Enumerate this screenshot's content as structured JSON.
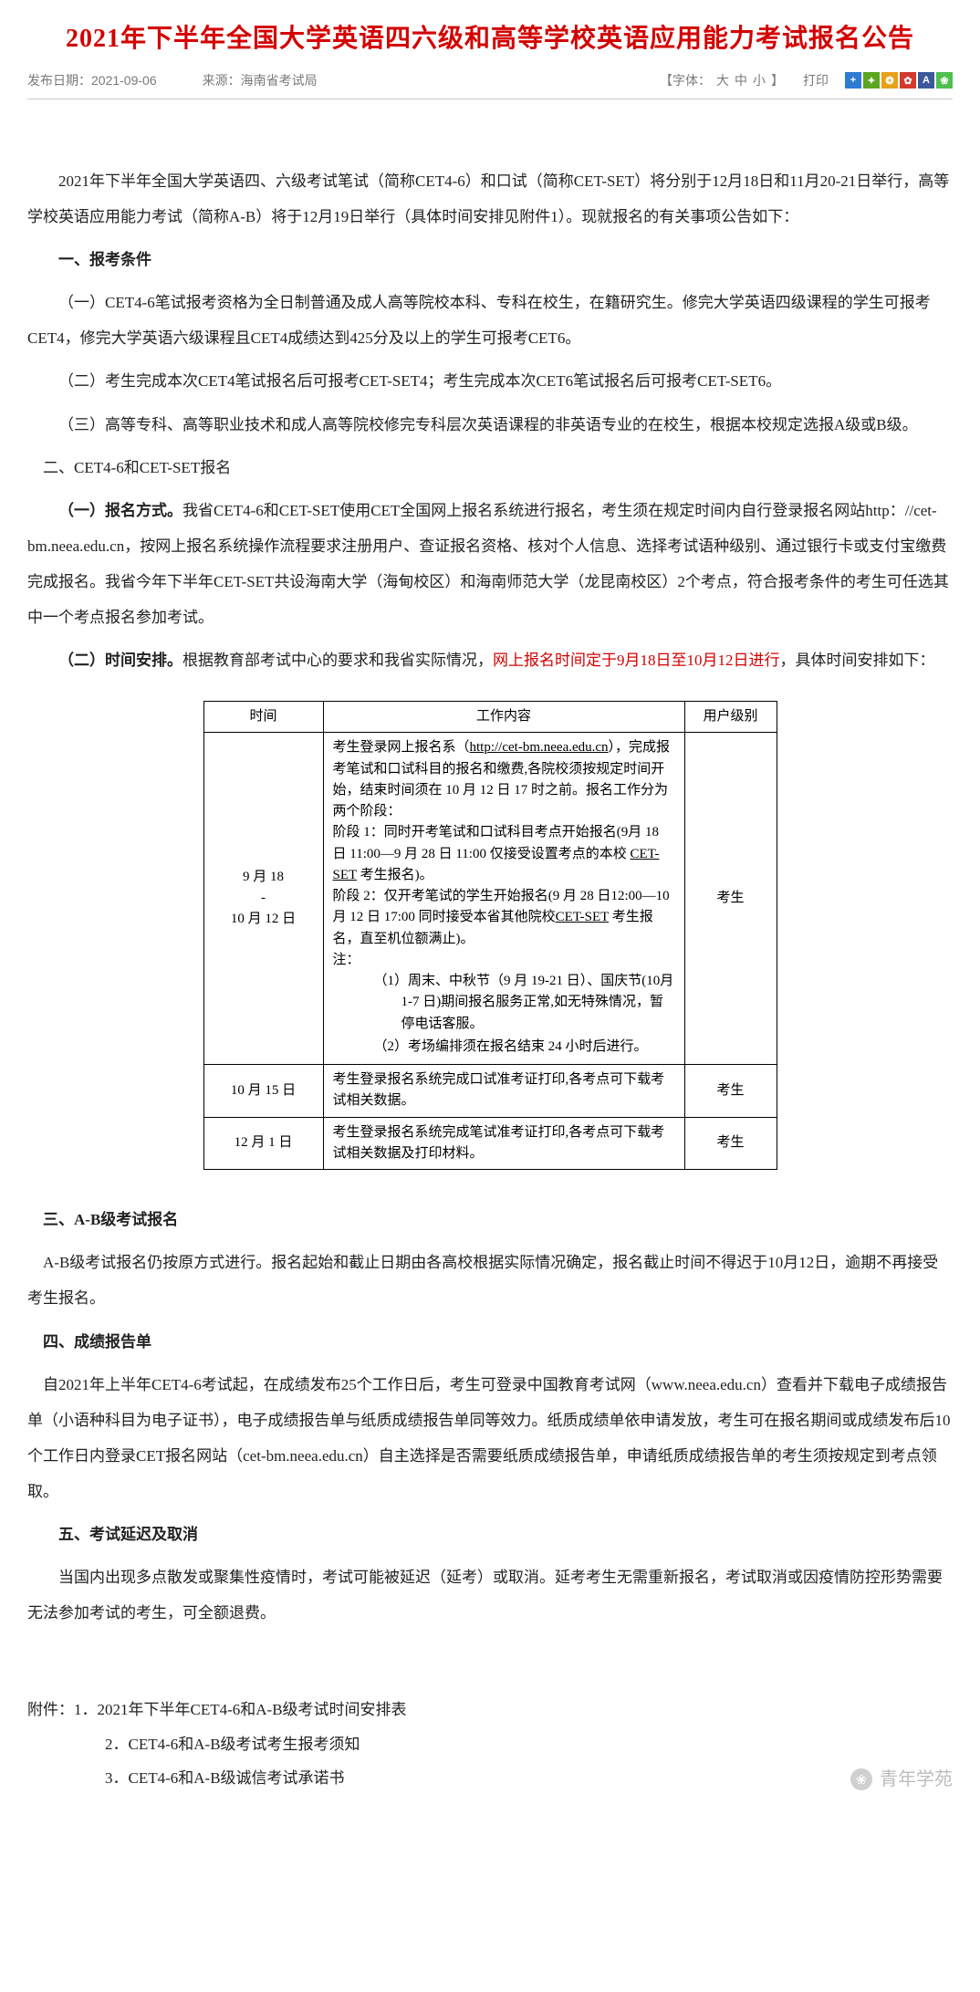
{
  "title": "2021年下半年全国大学英语四六级和高等学校英语应用能力考试报名公告",
  "meta": {
    "date_label": "发布日期：",
    "date": "2021-09-06",
    "source_label": "来源：",
    "source": "海南省考试局",
    "font_label": "【字体：",
    "font_large": "大",
    "font_mid": "中",
    "font_small": "小",
    "font_close": "】",
    "print": "打印"
  },
  "share_colors": [
    "#2f7bd4",
    "#5ca61f",
    "#e6a219",
    "#d23a2e",
    "#3b5998",
    "#4fbf4f"
  ],
  "intro": "2021年下半年全国大学英语四、六级考试笔试（简称CET4-6）和口试（简称CET-SET）将分别于12月18日和11月20-21日举行，高等学校英语应用能力考试（简称A-B）将于12月19日举行（具体时间安排见附件1）。现就报名的有关事项公告如下：",
  "h1": "一、报考条件",
  "c1a": "（一）CET4-6笔试报考资格为全日制普通及成人高等院校本科、专科在校生，在籍研究生。修完大学英语四级课程的学生可报考CET4，修完大学英语六级课程且CET4成绩达到425分及以上的学生可报考CET6。",
  "c1b": "（二）考生完成本次CET4笔试报名后可报考CET-SET4；考生完成本次CET6笔试报名后可报考CET-SET6。",
  "c1c": "（三）高等专科、高等职业技术和成人高等院校修完专科层次英语课程的非英语专业的在校生，根据本校规定选报A级或B级。",
  "h2": "二、CET4-6和CET-SET报名",
  "c2a_b": "（一）报名方式。",
  "c2a": "我省CET4-6和CET-SET使用CET全国网上报名系统进行报名，考生须在规定时间内自行登录报名网站http：//cet-bm.neea.edu.cn，按网上报名系统操作流程要求注册用户、查证报名资格、核对个人信息、选择考试语种级别、通过银行卡或支付宝缴费完成报名。我省今年下半年CET-SET共设海南大学（海甸校区）和海南师范大学（龙昆南校区）2个考点，符合报考条件的考生可任选其中一个考点报名参加考试。",
  "c2b_b": "（二）时间安排。",
  "c2b1": "根据教育部考试中心的要求和我省实际情况，",
  "c2b_red": "网上报名时间定于9月18日至10月12日进行",
  "c2b2": "，具体时间安排如下：",
  "table": {
    "h_time": "时间",
    "h_work": "工作内容",
    "h_role": "用户级别",
    "r1": {
      "time1": "9 月 18",
      "time2": "-",
      "time3": "10 月 12 日",
      "w_l1a": "考生登录网上报名系（",
      "w_url": "http://cet-bm.neea.edu.cn",
      "w_l1b": "），完成报考笔试和口试科目的报名和缴费,各院校须按规定时间开始，结束时间须在 10 月 12 日 17 时之前。报名工作分为两个阶段：",
      "w_l2a": "阶段 1：同时开考笔试和口试科目考点开始报名(9月 18 日 11:00—9 月 28 日 11:00 仅接受设置考点的本校 ",
      "w_u1": "CET-SET",
      "w_l2b": " 考生报名)。",
      "w_l3a": "阶段 2：仅开考笔试的学生开始报名(9 月 28 日12:00—10 月 12 日 17:00 同时接受本省其他院校",
      "w_u2": "CET-SET",
      "w_l3b": " 考生报名，直至机位额满止)。",
      "w_note": "注：",
      "w_n1": "（1）周末、中秋节（9 月 19-21 日）、国庆节(10月 1-7 日)期间报名服务正常,如无特殊情况，暂停电话客服。",
      "w_n2": "（2）考场编排须在报名结束 24 小时后进行。",
      "role": "考生"
    },
    "r2": {
      "time": "10 月 15 日",
      "work": "考生登录报名系统完成口试准考证打印,各考点可下载考试相关数据。",
      "role": "考生"
    },
    "r3": {
      "time": "12 月 1 日",
      "work": "考生登录报名系统完成笔试准考证打印,各考点可下载考试相关数据及打印材料。",
      "role": "考生"
    }
  },
  "h3": "三、A-B级考试报名",
  "c3": "A-B级考试报名仍按原方式进行。报名起始和截止日期由各高校根据实际情况确定，报名截止时间不得迟于10月12日，逾期不再接受考生报名。",
  "h4": "四、成绩报告单",
  "c4": "自2021年上半年CET4-6考试起，在成绩发布25个工作日后，考生可登录中国教育考试网（www.neea.edu.cn）查看并下载电子成绩报告单（小语种科目为电子证书），电子成绩报告单与纸质成绩报告单同等效力。纸质成绩单依申请发放，考生可在报名期间或成绩发布后10个工作日内登录CET报名网站（cet-bm.neea.edu.cn）自主选择是否需要纸质成绩报告单，申请纸质成绩报告单的考生须按规定到考点领取。",
  "h5": "五、考试延迟及取消",
  "c5": "当国内出现多点散发或聚集性疫情时，考试可能被延迟（延考）或取消。延考考生无需重新报名，考试取消或因疫情防控形势需要无法参加考试的考生，可全额退费。",
  "attach_label": "附件：",
  "attach1": "1．2021年下半年CET4-6和A-B级考试时间安排表",
  "attach2": "2．CET4-6和A-B级考试考生报考须知",
  "attach3": "3．CET4-6和A-B级诚信考试承诺书",
  "watermark": "青年学苑"
}
